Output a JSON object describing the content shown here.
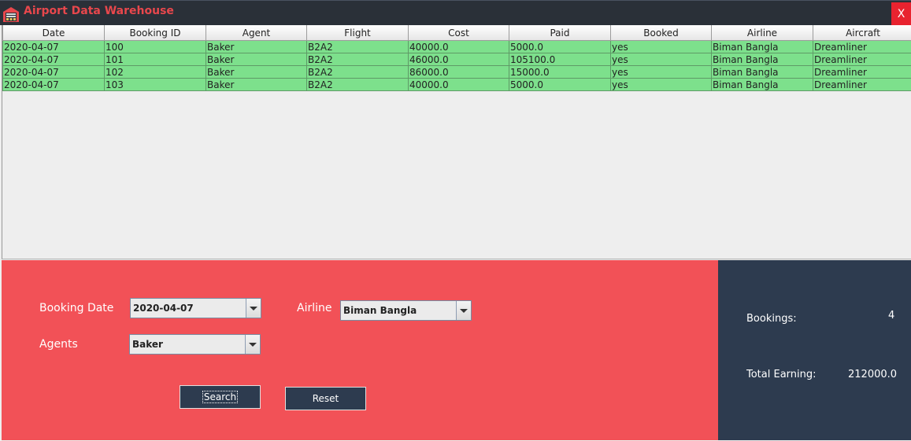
{
  "window": {
    "title": "Airport Data Warehouse",
    "close_label": "X"
  },
  "table": {
    "columns": [
      "Date",
      "Booking ID",
      "Agent",
      "Flight",
      "Cost",
      "Paid",
      "Booked",
      "Airline",
      "Aircraft"
    ],
    "rows": [
      [
        "2020-04-07",
        "100",
        "Baker",
        "B2A2",
        "40000.0",
        "5000.0",
        "yes",
        "Biman Bangla",
        "Dreamliner"
      ],
      [
        "2020-04-07",
        "101",
        "Baker",
        "B2A2",
        "46000.0",
        "105100.0",
        "yes",
        "Biman Bangla",
        "Dreamliner"
      ],
      [
        "2020-04-07",
        "102",
        "Baker",
        "B2A2",
        "86000.0",
        "15000.0",
        "yes",
        "Biman Bangla",
        "Dreamliner"
      ],
      [
        "2020-04-07",
        "103",
        "Baker",
        "B2A2",
        "40000.0",
        "5000.0",
        "yes",
        "Biman Bangla",
        "Dreamliner"
      ]
    ],
    "row_color": "#7de08c"
  },
  "filters": {
    "booking_date_label": "Booking Date",
    "booking_date_value": "2020-04-07",
    "airline_label": "Airline",
    "airline_value": "Biman Bangla",
    "agents_label": "Agents",
    "agents_value": "Baker",
    "search_label": "Search",
    "reset_label": "Reset"
  },
  "summary": {
    "bookings_label": "Bookings:",
    "bookings_value": "4",
    "earning_label": "Total Earning:",
    "earning_value": "212000.0"
  },
  "colors": {
    "accent_red": "#f25157",
    "dark_panel": "#2d3b4f",
    "close_red": "#e8232f"
  },
  "icons": {
    "app": "warehouse-icon",
    "dropdown": "chevron-down-icon"
  }
}
